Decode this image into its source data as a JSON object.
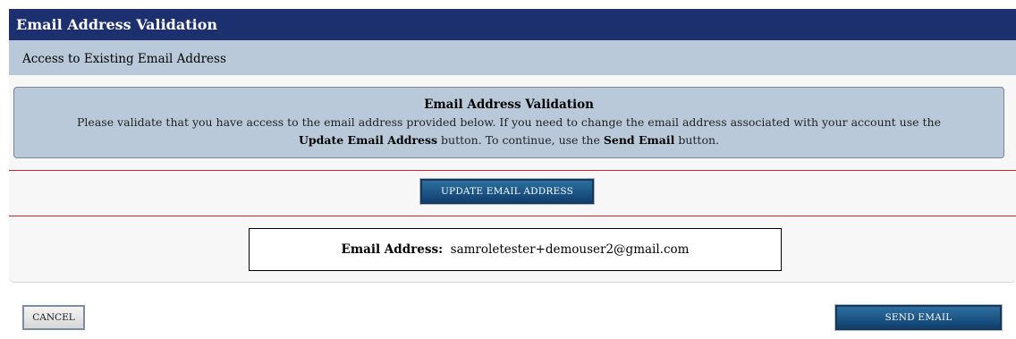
{
  "header": {
    "title": "Email Address Validation",
    "subtitle": "Access to Existing Email Address"
  },
  "info": {
    "title": "Email Address Validation",
    "text_part1": "Please validate that you have access to the email address provided below. If you need to change the email address associated with your account use the",
    "update_ref": "Update Email Address",
    "text_part2": " button. To continue, use the ",
    "send_ref": "Send Email",
    "text_part3": " button."
  },
  "buttons": {
    "update_email": "UPDATE EMAIL ADDRESS",
    "cancel": "CANCEL",
    "send_email": "SEND EMAIL"
  },
  "email": {
    "label": "Email Address:",
    "value": "samroletester+demouser2@gmail.com"
  },
  "colors": {
    "title_bar": "#1c2f6e",
    "sub_bar": "#b9c9d9",
    "button_blue": "#1a4f80",
    "divider_red": "#cc2a2a"
  }
}
